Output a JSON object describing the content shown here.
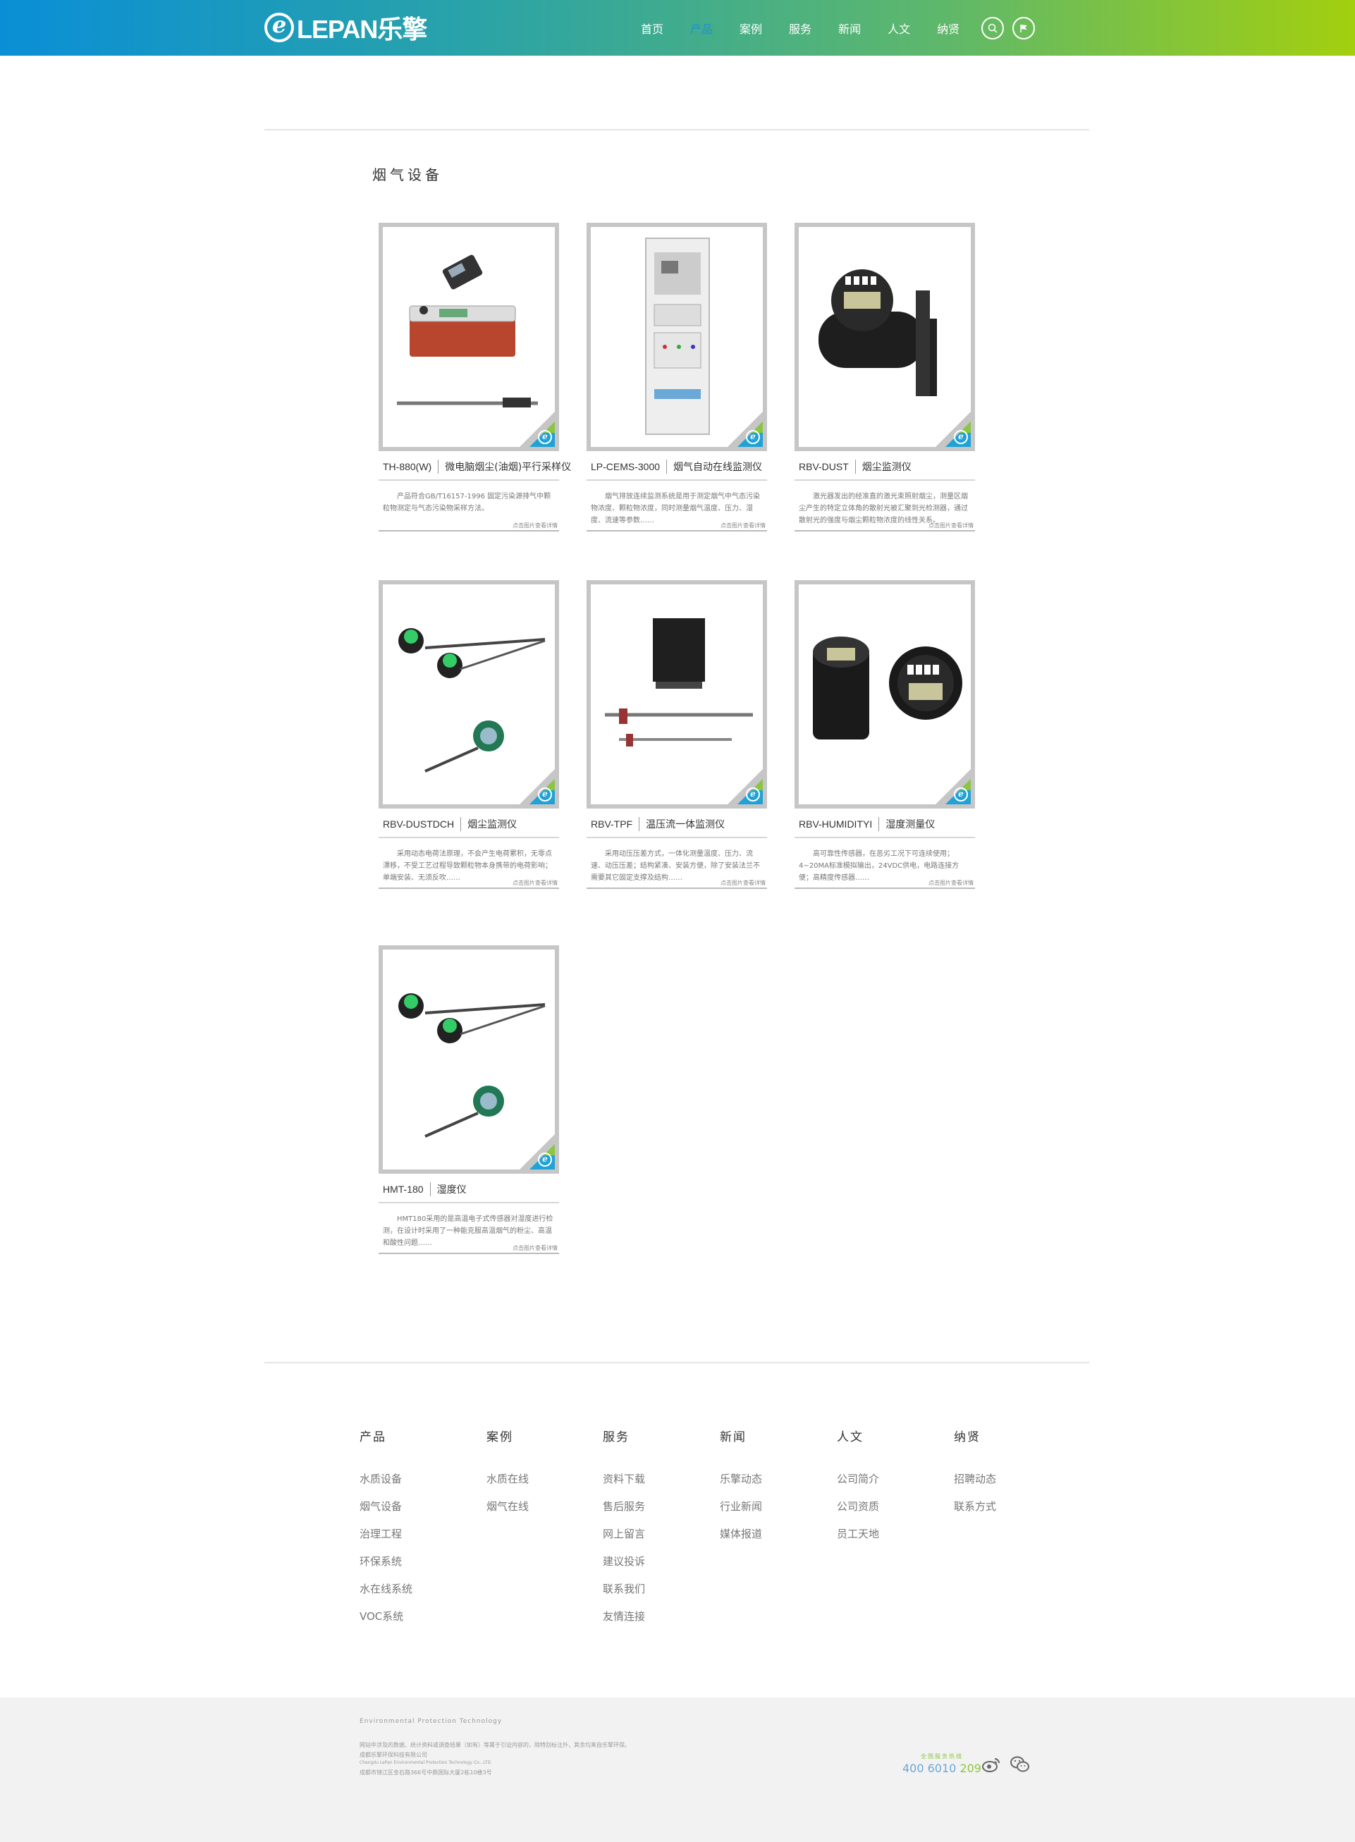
{
  "header": {
    "logo_text": "LEPAN乐擎",
    "nav": [
      "首页",
      "产品",
      "案例",
      "服务",
      "新闻",
      "人文",
      "纳贤"
    ],
    "active_index": 1
  },
  "section": {
    "title": "烟气设备"
  },
  "products": [
    {
      "model": "TH-880(W)",
      "name": "微电脑烟尘(油烟)平行采样仪",
      "desc": "产品符合GB/T16157-1996 固定污染源排气中颗粒物测定与气态污染物采样方法。",
      "more": "点击图片查看详情"
    },
    {
      "model": "LP-CEMS-3000",
      "name": "烟气自动在线监测仪",
      "desc": "烟气排放连续监测系统是用于测定烟气中气态污染物浓度、颗粒物浓度，同时测量烟气温度、压力、湿度、流速等参数……",
      "more": "点击图片查看详情"
    },
    {
      "model": "RBV-DUST",
      "name": "烟尘监测仪",
      "desc": "激光器发出的经准直的激光束照射烟尘，测量区烟尘产生的特定立体角的散射光被汇聚到光检测器，通过散射光的强度与烟尘颗粒物浓度的线性关系。",
      "more": "点击图片查看详情"
    },
    {
      "model": "RBV-DUSTDCH",
      "name": "烟尘监测仪",
      "desc": "采用动态电荷法原理，不会产生电荷累积，无零点漂移，不受工艺过程导致颗粒物本身携带的电荷影响；单端安装、无须反吹……",
      "more": "点击图片查看详情"
    },
    {
      "model": "RBV-TPF",
      "name": "温压流一体监测仪",
      "desc": "采用动压压差方式，一体化测量温度、压力、流速、动压压差；结构紧凑、安装方便，除了安装法兰不需要其它固定支撑及结构……",
      "more": "点击图片查看详情"
    },
    {
      "model": "RBV-HUMIDITYI",
      "name": "湿度测量仪",
      "desc": "高可靠性传感器，在恶劣工况下可连续使用；4~20MA标准模拟输出，24VDC供电，电路连接方便；高精度传感器……",
      "more": "点击图片查看详情"
    },
    {
      "model": "HMT-180",
      "name": "湿度仪",
      "desc": "HMT180采用的是高温电子式传感器对湿度进行检测，在设计时采用了一种能克服高温烟气的粉尘、高温和酸性问题……",
      "more": "点击图片查看详情"
    }
  ],
  "footer": {
    "columns": [
      {
        "title": "产品",
        "items": [
          "水质设备",
          "烟气设备",
          "治理工程",
          "环保系统",
          "水在线系统",
          "VOC系统"
        ]
      },
      {
        "title": "案例",
        "items": [
          "水质在线",
          "烟气在线"
        ]
      },
      {
        "title": "服务",
        "items": [
          "资料下载",
          "售后服务",
          "网上留言",
          "建议投诉",
          "联系我们",
          "友情连接"
        ]
      },
      {
        "title": "新闻",
        "items": [
          "乐擎动态",
          "行业新闻",
          "媒体报道"
        ]
      },
      {
        "title": "人文",
        "items": [
          "公司简介",
          "公司资质",
          "员工天地"
        ]
      },
      {
        "title": "纳贤",
        "items": [
          "招聘动态",
          "联系方式"
        ]
      }
    ],
    "tagline": "Environmental  Protection  Technology",
    "lines": [
      "网站中涉及的数据、统计资料或调查结果（如有）等属于引证内容的，除特别标注外，其余均来自乐擎环保。",
      "成都乐擎环保科技有限公司",
      "Chengdu LePan Environmental Protection Technology Co., LTD",
      "成都市锦江区金石路366号中鼎国际大厦2栋10楼3号"
    ],
    "hotline_label": "全国服务热线",
    "hotline_a": "400 6010 ",
    "hotline_b": "209"
  }
}
